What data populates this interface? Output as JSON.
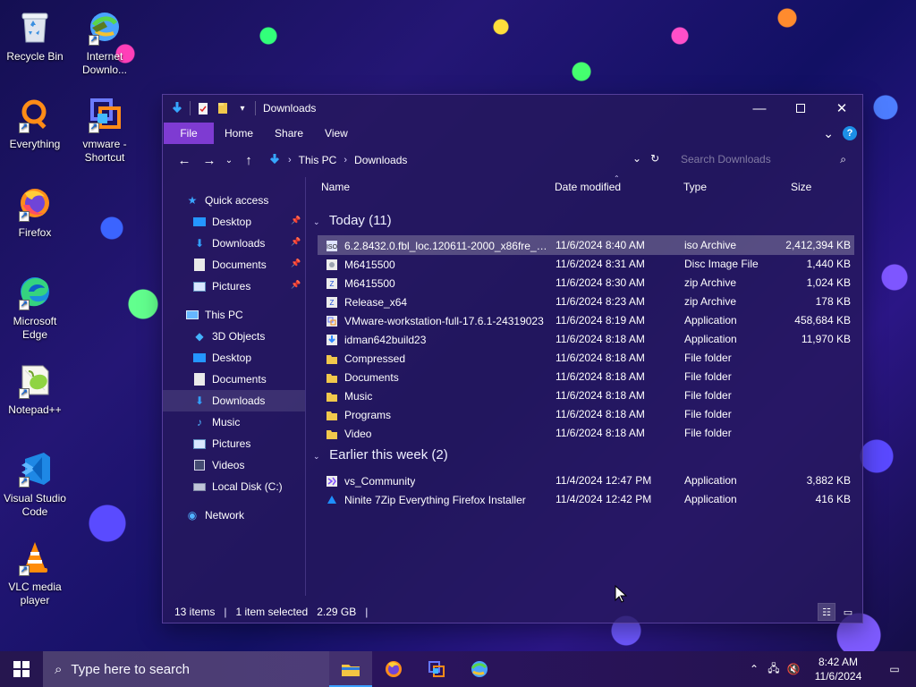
{
  "desktop": {
    "icons": [
      {
        "label": "Recycle Bin"
      },
      {
        "label": "Internet Downlo..."
      },
      {
        "label": "Everything"
      },
      {
        "label": "vmware - Shortcut"
      },
      {
        "label": "Firefox"
      },
      {
        "label": "Microsoft Edge"
      },
      {
        "label": "Notepad++"
      },
      {
        "label": "Visual Studio Code"
      },
      {
        "label": "VLC media player"
      }
    ]
  },
  "window": {
    "title": "Downloads",
    "ribbon": {
      "file": "File",
      "home": "Home",
      "share": "Share",
      "view": "View"
    },
    "address": {
      "this_pc": "This PC",
      "downloads": "Downloads"
    },
    "search": {
      "placeholder": "Search Downloads"
    },
    "sidebar": {
      "quick_access": "Quick access",
      "quick_items": [
        {
          "label": "Desktop"
        },
        {
          "label": "Downloads"
        },
        {
          "label": "Documents"
        },
        {
          "label": "Pictures"
        }
      ],
      "this_pc": "This PC",
      "pc_items": [
        {
          "label": "3D Objects"
        },
        {
          "label": "Desktop"
        },
        {
          "label": "Documents"
        },
        {
          "label": "Downloads"
        },
        {
          "label": "Music"
        },
        {
          "label": "Pictures"
        },
        {
          "label": "Videos"
        },
        {
          "label": "Local Disk (C:)"
        }
      ],
      "network": "Network"
    },
    "columns": {
      "name": "Name",
      "date_modified": "Date modified",
      "type": "Type",
      "size": "Size"
    },
    "groups": [
      {
        "title": "Today (11)",
        "rows": [
          {
            "name": "6.2.8432.0.fbl_loc.120611-2000_x86fre_clie...",
            "date": "11/6/2024 8:40 AM",
            "type": "iso Archive",
            "size": "2,412,394 KB"
          },
          {
            "name": "M6415500",
            "date": "11/6/2024 8:31 AM",
            "type": "Disc Image File",
            "size": "1,440 KB"
          },
          {
            "name": "M6415500",
            "date": "11/6/2024 8:30 AM",
            "type": "zip Archive",
            "size": "1,024 KB"
          },
          {
            "name": "Release_x64",
            "date": "11/6/2024 8:23 AM",
            "type": "zip Archive",
            "size": "178 KB"
          },
          {
            "name": "VMware-workstation-full-17.6.1-24319023",
            "date": "11/6/2024 8:19 AM",
            "type": "Application",
            "size": "458,684 KB"
          },
          {
            "name": "idman642build23",
            "date": "11/6/2024 8:18 AM",
            "type": "Application",
            "size": "11,970 KB"
          },
          {
            "name": "Compressed",
            "date": "11/6/2024 8:18 AM",
            "type": "File folder",
            "size": ""
          },
          {
            "name": "Documents",
            "date": "11/6/2024 8:18 AM",
            "type": "File folder",
            "size": ""
          },
          {
            "name": "Music",
            "date": "11/6/2024 8:18 AM",
            "type": "File folder",
            "size": ""
          },
          {
            "name": "Programs",
            "date": "11/6/2024 8:18 AM",
            "type": "File folder",
            "size": ""
          },
          {
            "name": "Video",
            "date": "11/6/2024 8:18 AM",
            "type": "File folder",
            "size": ""
          }
        ]
      },
      {
        "title": "Earlier this week (2)",
        "rows": [
          {
            "name": "vs_Community",
            "date": "11/4/2024 12:47 PM",
            "type": "Application",
            "size": "3,882 KB"
          },
          {
            "name": "Ninite 7Zip Everything Firefox Installer",
            "date": "11/4/2024 12:42 PM",
            "type": "Application",
            "size": "416 KB"
          }
        ]
      }
    ],
    "status": {
      "items": "13 items",
      "selected": "1 item selected",
      "selected_size": "2.29 GB"
    }
  },
  "taskbar": {
    "search_placeholder": "Type here to search",
    "time": "8:42 AM",
    "date": "11/6/2024"
  }
}
